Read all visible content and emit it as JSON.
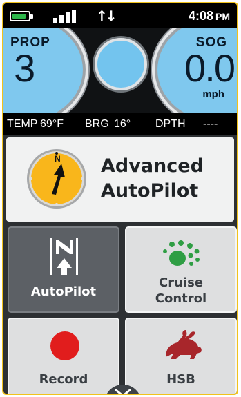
{
  "status": {
    "time": "4:08",
    "ampm": "PM",
    "battery_level": 0.85
  },
  "gauges": {
    "left": {
      "label": "PROP",
      "value": "3"
    },
    "right": {
      "label": "SOG",
      "value": "0.0",
      "unit": "mph"
    }
  },
  "readouts": {
    "temp_label": "TEMP",
    "temp_value": "69°F",
    "brg_label": "BRG",
    "brg_value": "16°",
    "dpth_label": "DPTH",
    "dpth_value": "----"
  },
  "header": {
    "title_line1": "Advanced",
    "title_line2": "AutoPilot",
    "compass_letter": "N"
  },
  "tiles": [
    {
      "label": "AutoPilot"
    },
    {
      "label_line1": "Cruise",
      "label_line2": "Control"
    },
    {
      "label": "Record"
    },
    {
      "label": "HSB"
    }
  ],
  "colors": {
    "accent": "#f9b61b",
    "battery": "#2db64b",
    "record": "#e11d1d",
    "cruise": "#2f9e44",
    "hsb": "#a8262b",
    "gauge_face": "#7fc8ee"
  }
}
